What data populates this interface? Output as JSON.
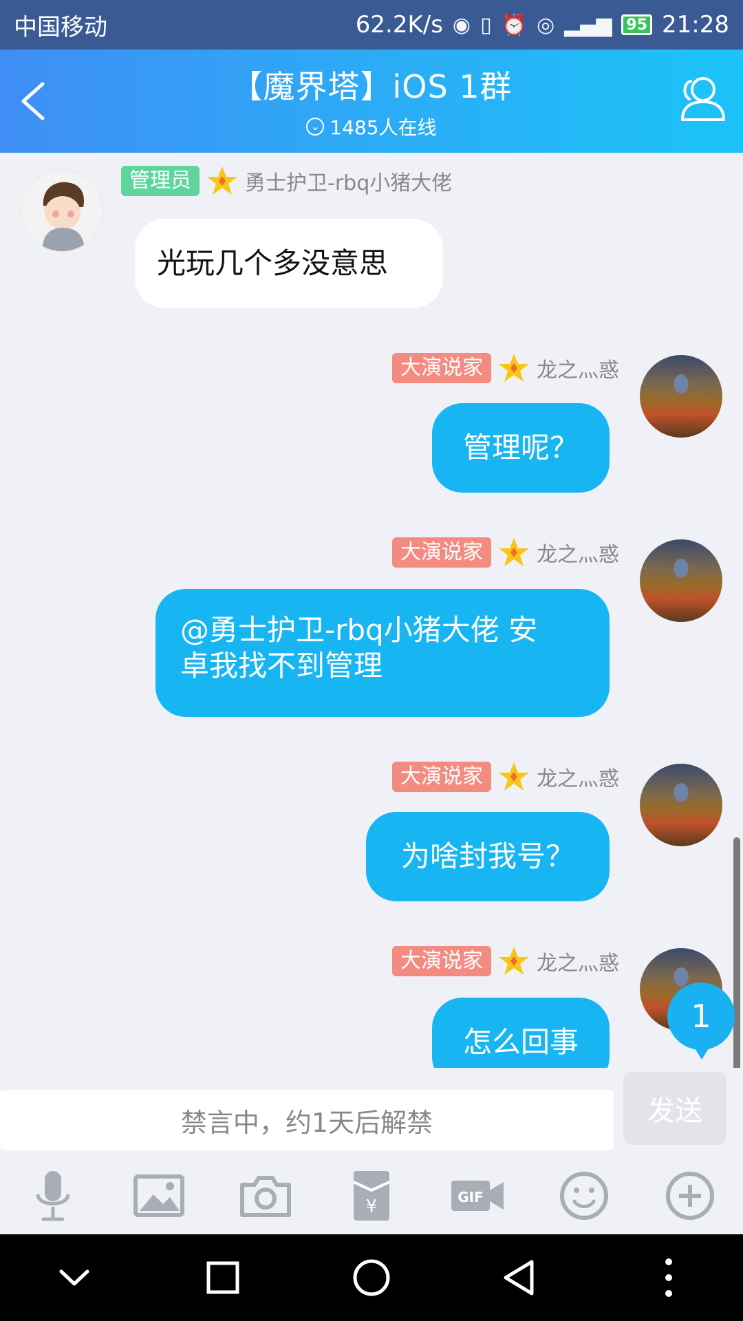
{
  "status_bar": {
    "carrier": "中国移动",
    "speed": "62.2K/s",
    "battery": "95",
    "time": "21:28"
  },
  "header": {
    "back_icon": "chevron-left-icon",
    "title": "【魔界塔】iOS 1群",
    "online_count": "1485人在线",
    "members_icon": "group-members-icon"
  },
  "messages": [
    {
      "direction": "in",
      "badge": "管理员",
      "badge_color": "#5fd49d",
      "sender": "勇士护卫-rbq小猪大佬",
      "text": "光玩几个多没意思"
    },
    {
      "direction": "out",
      "badge": "大演说家",
      "badge_color": "#f48b80",
      "sender": "龙之灬惑",
      "text": "管理呢？"
    },
    {
      "direction": "out",
      "badge": "大演说家",
      "badge_color": "#f48b80",
      "sender": "龙之灬惑",
      "text_line1": "@勇士护卫-rbq小猪大佬 安",
      "text_line2": "卓我找不到管理"
    },
    {
      "direction": "out",
      "badge": "大演说家",
      "badge_color": "#f48b80",
      "sender": "龙之灬惑",
      "text": "为啥封我号？"
    },
    {
      "direction": "out",
      "badge": "大演说家",
      "badge_color": "#f48b80",
      "sender": "龙之灬惑",
      "text": "怎么回事"
    }
  ],
  "unread_count": "1",
  "input": {
    "mute_notice": "禁言中，约1天后解禁",
    "send_label": "发送"
  },
  "toolbar": [
    "microphone-icon",
    "image-icon",
    "camera-icon",
    "red-packet-icon",
    "gif-icon",
    "emoji-icon",
    "plus-icon"
  ],
  "navbar": [
    "collapse-icon",
    "recent-apps-icon",
    "home-icon",
    "back-icon",
    "more-icon"
  ],
  "colors": {
    "header_start": "#3f8ef5",
    "header_end": "#1cc3f8",
    "bubble_out": "#18b5f3",
    "bubble_in": "#ffffff",
    "chat_bg": "#eff1f6"
  }
}
